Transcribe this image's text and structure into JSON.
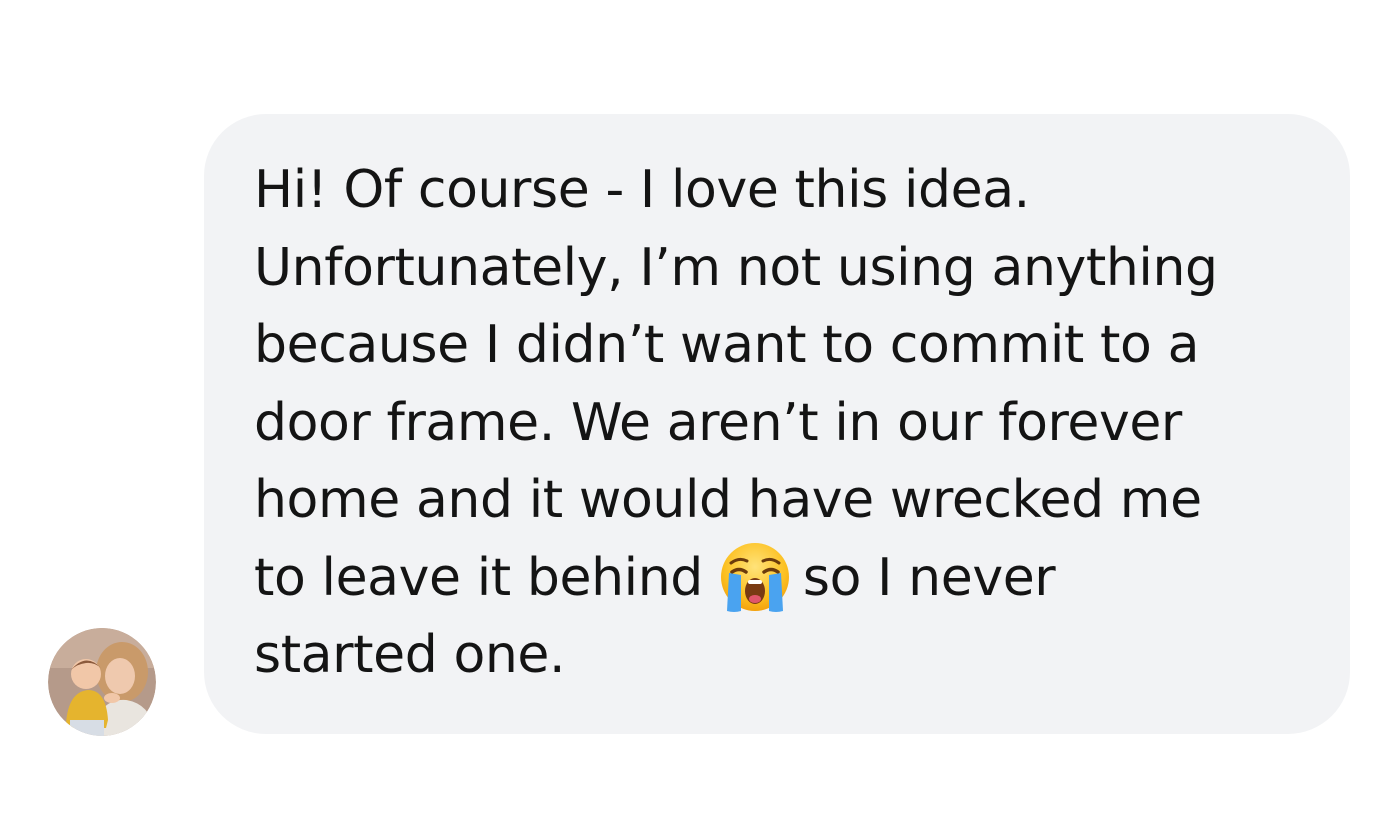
{
  "message": {
    "lines": [
      "Hi! Of course - I love this idea.",
      "Unfortunately, I’m not using anything",
      "because I didn’t want to commit to a",
      "door frame. We aren’t in our forever",
      "home and it would have wrecked me"
    ],
    "line6_before": "to leave it behind",
    "line6_after": "so I never",
    "line7": "started one.",
    "emoji": "loudly-crying-face-icon"
  },
  "sender": {
    "avatar": "profile-photo-avatar"
  },
  "colors": {
    "bubble": "#f2f3f5",
    "text": "#141414",
    "background": "#ffffff"
  }
}
